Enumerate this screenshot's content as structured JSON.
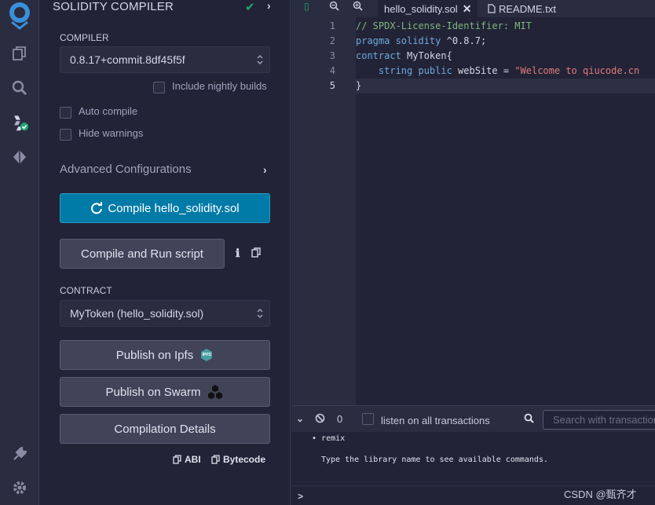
{
  "rail": {
    "icons": [
      "remix-logo-icon",
      "file-explorer-icon",
      "search-icon",
      "solidity-compiler-icon",
      "deploy-run-icon",
      "plugin-manager-icon",
      "settings-icon"
    ]
  },
  "panel": {
    "title": "SOLIDITY COMPILER",
    "compiler_label": "COMPILER",
    "compiler_version": "0.8.17+commit.8df45f5f",
    "include_nightly": "Include nightly builds",
    "auto_compile": "Auto compile",
    "hide_warnings": "Hide warnings",
    "advanced": "Advanced Configurations",
    "compile_button": "Compile hello_solidity.sol",
    "compile_run_button": "Compile and Run script",
    "contract_label": "CONTRACT",
    "contract_value": "MyToken (hello_solidity.sol)",
    "publish_ipfs": "Publish on Ipfs",
    "ipfs_badge": "IPFS",
    "publish_swarm": "Publish on Swarm",
    "compilation_details": "Compilation Details",
    "abi": "ABI",
    "bytecode": "Bytecode"
  },
  "editor": {
    "tabs": [
      {
        "label": "hello_solidity.sol",
        "active": true
      },
      {
        "label": "README.txt",
        "active": false
      }
    ],
    "line_numbers": [
      "1",
      "2",
      "3",
      "4",
      "5"
    ],
    "lines": {
      "l1": "// SPDX-License-Identifier: MIT",
      "l2_kw": "pragma solidity",
      "l2_rest": " ^0.8.7;",
      "l3_kw": "contract",
      "l3_rest": " MyToken{",
      "l4_indent": "    ",
      "l4_kw": "string public",
      "l4_mid": " webSite = ",
      "l4_str": "\"Welcome to qiucode.cn",
      "l5": "}"
    }
  },
  "terminal": {
    "count": "0",
    "listen_label": "listen on all transactions",
    "search_placeholder": "Search with transaction hash or address",
    "bullet": "remix",
    "help_text": "Type the library name to see available commands.",
    "prompt": ">",
    "watermark": "CSDN @甄齐才"
  },
  "colors": {
    "accent": "#007aa6",
    "success": "#1ea672",
    "background": "#222336"
  }
}
